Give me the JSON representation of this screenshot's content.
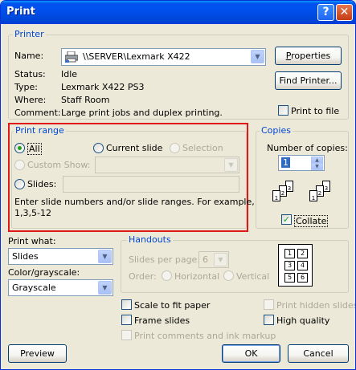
{
  "window": {
    "title": "Print",
    "help": "?",
    "close": "✕"
  },
  "printer": {
    "group_label": "Printer",
    "name_label": "Name:",
    "name_value": "\\\\SERVER\\Lexmark X422",
    "status_label": "Status:",
    "status_value": "Idle",
    "type_label": "Type:",
    "type_value": "Lexmark X422 PS3",
    "where_label": "Where:",
    "where_value": "Staff Room",
    "comment_label": "Comment:",
    "comment_value": "Large print jobs and duplex printing.",
    "properties_button": "Properties",
    "find_printer_button": "Find Printer...",
    "print_to_file_label": "Print to file",
    "print_to_file_checked": false
  },
  "print_range": {
    "group_label": "Print range",
    "all_label": "All",
    "current_slide_label": "Current slide",
    "selection_label": "Selection",
    "custom_show_label": "Custom Show:",
    "slides_label": "Slides:",
    "slides_value": "",
    "hint": "Enter slide numbers and/or slide ranges. For example,",
    "hint_example": "1,3,5-12",
    "selected": "All"
  },
  "copies": {
    "group_label": "Copies",
    "number_label": "Number of copies:",
    "number_value": "1",
    "collate_label": "Collate",
    "collate_checked": true,
    "page_numbers": [
      "1",
      "2",
      "3"
    ]
  },
  "print_what": {
    "label": "Print what:",
    "value": "Slides"
  },
  "color": {
    "label": "Color/grayscale:",
    "value": "Grayscale"
  },
  "handouts": {
    "group_label": "Handouts",
    "slides_per_page_label": "Slides per page:",
    "slides_per_page_value": "6",
    "order_label": "Order:",
    "horizontal_label": "Horizontal",
    "vertical_label": "Vertical",
    "preview_cells": [
      "1",
      "2",
      "3",
      "4",
      "5",
      "6"
    ]
  },
  "options": {
    "scale_to_fit": "Scale to fit paper",
    "frame_slides": "Frame slides",
    "print_comments": "Print comments and ink markup",
    "print_hidden": "Print hidden slides",
    "high_quality": "High quality"
  },
  "buttons": {
    "preview": "Preview",
    "ok": "OK",
    "cancel": "Cancel"
  },
  "colors": {
    "titlebar": "#0053ee",
    "dialog_bg": "#ece9d8",
    "group_label": "#0046d5",
    "highlight_box": "#e01818"
  }
}
